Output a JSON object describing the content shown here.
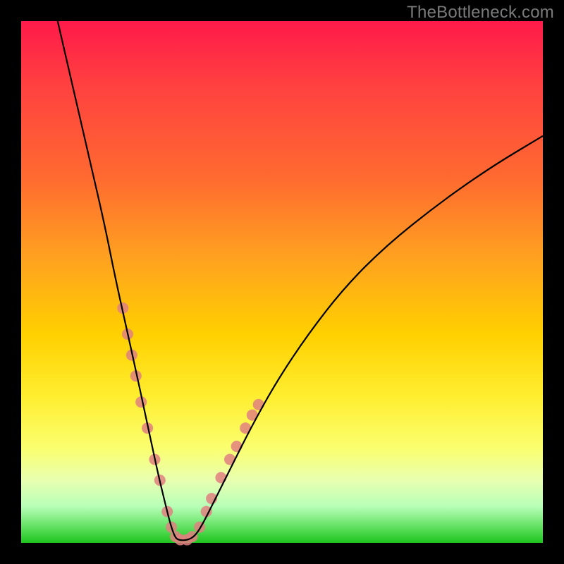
{
  "watermark": "TheBottleneck.com",
  "chart_data": {
    "type": "line",
    "title": "",
    "xlabel": "",
    "ylabel": "",
    "xlim": [
      0,
      100
    ],
    "ylim": [
      0,
      100
    ],
    "grid": false,
    "series": [
      {
        "name": "bottleneck-curve",
        "color": "#000000",
        "x": [
          7,
          10,
          13,
          16,
          18,
          20,
          22,
          23.5,
          25,
          26.3,
          27.5,
          28.5,
          29.3,
          30,
          32,
          33.5,
          35,
          37,
          40,
          44,
          49,
          55,
          62,
          70,
          80,
          90,
          100
        ],
        "y": [
          100,
          87,
          74,
          61,
          51,
          42,
          33,
          26,
          19,
          13,
          8,
          4,
          1.5,
          0.5,
          0.5,
          1.5,
          4,
          8,
          14,
          22,
          31,
          40,
          49,
          57,
          65,
          72,
          78
        ]
      }
    ],
    "markers": {
      "name": "highlight-dots",
      "color": "#e08080",
      "radius_px": 8,
      "points": [
        {
          "x": 19.5,
          "y": 45
        },
        {
          "x": 20.4,
          "y": 40
        },
        {
          "x": 21.2,
          "y": 36
        },
        {
          "x": 22.0,
          "y": 32
        },
        {
          "x": 23.0,
          "y": 27
        },
        {
          "x": 24.2,
          "y": 22
        },
        {
          "x": 25.6,
          "y": 16
        },
        {
          "x": 26.6,
          "y": 12
        },
        {
          "x": 28.0,
          "y": 6
        },
        {
          "x": 28.8,
          "y": 3
        },
        {
          "x": 29.6,
          "y": 1.2
        },
        {
          "x": 30.5,
          "y": 0.6
        },
        {
          "x": 31.8,
          "y": 0.6
        },
        {
          "x": 32.8,
          "y": 1.2
        },
        {
          "x": 34.2,
          "y": 3
        },
        {
          "x": 35.5,
          "y": 6
        },
        {
          "x": 36.5,
          "y": 8.5
        },
        {
          "x": 38.3,
          "y": 12.5
        },
        {
          "x": 40.0,
          "y": 16
        },
        {
          "x": 41.3,
          "y": 18.5
        },
        {
          "x": 43.0,
          "y": 22
        },
        {
          "x": 44.3,
          "y": 24.5
        },
        {
          "x": 45.5,
          "y": 26.5
        }
      ]
    }
  }
}
